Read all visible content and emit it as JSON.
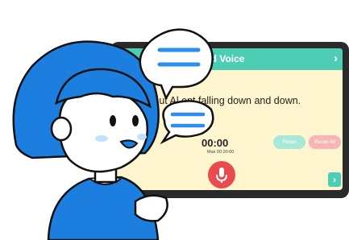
{
  "screen": {
    "title": "rd Voice",
    "prompt_text": "But Al     ent falling down and down.",
    "timer": "00:00",
    "timer_max": "Max 00:20:00",
    "reset_label": "Reset",
    "reset_all_label": "Reset All",
    "next_glyph": "›",
    "header_glyph": "›"
  },
  "colors": {
    "header": "#4ecdb5",
    "screen_bg": "#fff6cf",
    "hair": "#1c7fe0",
    "mic": "#e84c4c",
    "bubble_lines": "#2a8ef0"
  },
  "icons": [
    "microphone-icon",
    "chevron-right-icon",
    "speech-bubble-icon"
  ]
}
